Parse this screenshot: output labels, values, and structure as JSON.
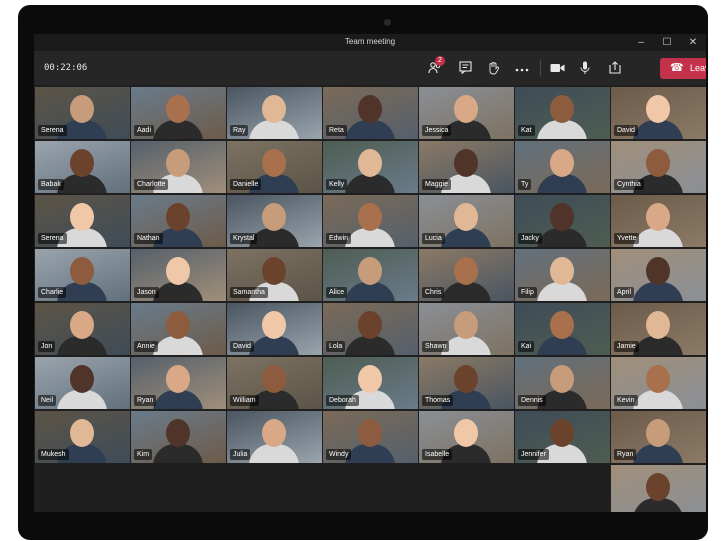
{
  "window": {
    "title": "Team meeting",
    "minimize": "–",
    "maximize": "☐",
    "close": "✕"
  },
  "toolbar": {
    "timer": "00:22:06",
    "participants_icon": "people-icon",
    "participants_badge": "2",
    "chat_icon": "chat-icon",
    "raise_hand_icon": "hand-icon",
    "more_icon": "more-icon",
    "camera_icon": "camera-icon",
    "mic_icon": "mic-icon",
    "share_icon": "share-icon",
    "leave_label": "Leave",
    "leave_color": "#c4314b"
  },
  "participants": [
    [
      "Serena",
      "Aadi",
      "Ray",
      "Reta",
      "Jessica",
      "Kat",
      "David"
    ],
    [
      "Babak",
      "Charlotte",
      "Danielle",
      "Kelly",
      "Maggie",
      "Ty",
      "Cynthia"
    ],
    [
      "Serena",
      "Nathan",
      "Krystal",
      "Edwin",
      "Lucia",
      "Jacky",
      "Yvette"
    ],
    [
      "Charlie",
      "Jason",
      "Samantha",
      "Alice",
      "Chris",
      "Filip",
      "April"
    ],
    [
      "Jon",
      "Annie",
      "David",
      "Lola",
      "Shawn",
      "Kai",
      "Jamie"
    ],
    [
      "Neil",
      "Ryan",
      "William",
      "Deborah",
      "Thomas",
      "Dennis",
      "Kevin"
    ],
    [
      "Mukesh",
      "Kim",
      "Julia",
      "Windy",
      "Isabelle",
      "Jennifer",
      "Ryan"
    ],
    [
      "",
      "",
      "",
      "",
      "",
      "",
      ""
    ]
  ]
}
